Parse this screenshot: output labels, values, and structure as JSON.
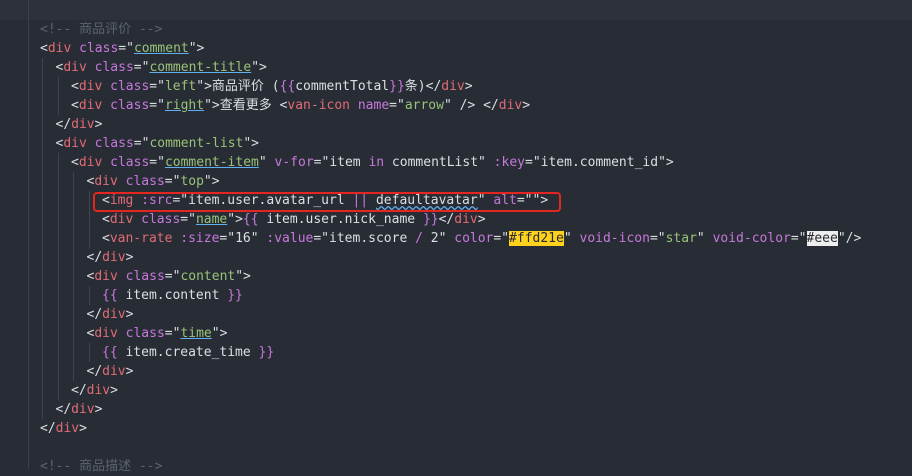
{
  "editor": {
    "highlight_color": "#e3261f",
    "swatch_colors": [
      "#ffd21e",
      "#eeeeee"
    ],
    "lines": [
      {
        "indent": 0,
        "tokens": [
          {
            "t": "<!-- 商品评价 -->",
            "c": "comment"
          }
        ]
      },
      {
        "indent": 0,
        "tokens": [
          {
            "t": "<",
            "c": "punc"
          },
          {
            "t": "div",
            "c": "tag"
          },
          {
            "t": " class",
            "c": "attr"
          },
          {
            "t": "=\"",
            "c": "punc"
          },
          {
            "t": "comment",
            "c": "str under"
          },
          {
            "t": "\">",
            "c": "punc"
          }
        ]
      },
      {
        "indent": 1,
        "tokens": [
          {
            "t": "<",
            "c": "punc"
          },
          {
            "t": "div",
            "c": "tag"
          },
          {
            "t": " class",
            "c": "attr"
          },
          {
            "t": "=\"",
            "c": "punc"
          },
          {
            "t": "comment-title",
            "c": "str under"
          },
          {
            "t": "\">",
            "c": "punc"
          }
        ]
      },
      {
        "indent": 2,
        "tokens": [
          {
            "t": "<",
            "c": "punc"
          },
          {
            "t": "div",
            "c": "tag"
          },
          {
            "t": " class",
            "c": "attr"
          },
          {
            "t": "=\"",
            "c": "punc"
          },
          {
            "t": "left",
            "c": "str"
          },
          {
            "t": "\">",
            "c": "punc"
          },
          {
            "t": "商品评价 (",
            "c": "plain"
          },
          {
            "t": "{{",
            "c": "attr"
          },
          {
            "t": "commentTotal",
            "c": "plain"
          },
          {
            "t": "}}",
            "c": "attr"
          },
          {
            "t": "条)",
            "c": "plain"
          },
          {
            "t": "</",
            "c": "punc"
          },
          {
            "t": "div",
            "c": "tag"
          },
          {
            "t": ">",
            "c": "punc"
          }
        ]
      },
      {
        "indent": 2,
        "tokens": [
          {
            "t": "<",
            "c": "punc"
          },
          {
            "t": "div",
            "c": "tag"
          },
          {
            "t": " class",
            "c": "attr"
          },
          {
            "t": "=\"",
            "c": "punc"
          },
          {
            "t": "right",
            "c": "str under"
          },
          {
            "t": "\">",
            "c": "punc"
          },
          {
            "t": "查看更多 ",
            "c": "plain"
          },
          {
            "t": "<",
            "c": "punc"
          },
          {
            "t": "van-icon",
            "c": "tag"
          },
          {
            "t": " name",
            "c": "attr"
          },
          {
            "t": "=\"",
            "c": "punc"
          },
          {
            "t": "arrow",
            "c": "str"
          },
          {
            "t": "\" /> ",
            "c": "punc"
          },
          {
            "t": "</",
            "c": "punc"
          },
          {
            "t": "div",
            "c": "tag"
          },
          {
            "t": ">",
            "c": "punc"
          }
        ]
      },
      {
        "indent": 1,
        "tokens": [
          {
            "t": "</",
            "c": "punc"
          },
          {
            "t": "div",
            "c": "tag"
          },
          {
            "t": ">",
            "c": "punc"
          }
        ]
      },
      {
        "indent": 1,
        "tokens": [
          {
            "t": "<",
            "c": "punc"
          },
          {
            "t": "div",
            "c": "tag"
          },
          {
            "t": " class",
            "c": "attr"
          },
          {
            "t": "=\"",
            "c": "punc"
          },
          {
            "t": "comment-list",
            "c": "str"
          },
          {
            "t": "\">",
            "c": "punc"
          }
        ]
      },
      {
        "indent": 2,
        "tokens": [
          {
            "t": "<",
            "c": "punc"
          },
          {
            "t": "div",
            "c": "tag"
          },
          {
            "t": " class",
            "c": "attr"
          },
          {
            "t": "=\"",
            "c": "punc"
          },
          {
            "t": "comment-item",
            "c": "str under"
          },
          {
            "t": "\"",
            "c": "punc"
          },
          {
            "t": " v-for",
            "c": "attr"
          },
          {
            "t": "=\"",
            "c": "punc"
          },
          {
            "t": "item ",
            "c": "plain"
          },
          {
            "t": "in",
            "c": "kw"
          },
          {
            "t": " commentList",
            "c": "plain"
          },
          {
            "t": "\"",
            "c": "punc"
          },
          {
            "t": " :key",
            "c": "attr"
          },
          {
            "t": "=\"",
            "c": "punc"
          },
          {
            "t": "item.comment_id",
            "c": "plain"
          },
          {
            "t": "\">",
            "c": "punc"
          }
        ]
      },
      {
        "indent": 3,
        "tokens": [
          {
            "t": "<",
            "c": "punc"
          },
          {
            "t": "div",
            "c": "tag"
          },
          {
            "t": " class",
            "c": "attr"
          },
          {
            "t": "=\"",
            "c": "punc"
          },
          {
            "t": "top",
            "c": "str"
          },
          {
            "t": "\">",
            "c": "punc"
          }
        ]
      },
      {
        "indent": 4,
        "tokens": [
          {
            "t": "<",
            "c": "punc"
          },
          {
            "t": "img",
            "c": "tag"
          },
          {
            "t": " :src",
            "c": "attr"
          },
          {
            "t": "=\"",
            "c": "punc"
          },
          {
            "t": "item.user.avatar_url ",
            "c": "plain"
          },
          {
            "t": "||",
            "c": "kw"
          },
          {
            "t": " ",
            "c": "plain"
          },
          {
            "t": "defaultavatar",
            "c": "plain wavy"
          },
          {
            "t": "\"",
            "c": "punc"
          },
          {
            "t": " alt",
            "c": "attr"
          },
          {
            "t": "=\"\">",
            "c": "punc"
          }
        ]
      },
      {
        "indent": 4,
        "tokens": [
          {
            "t": "<",
            "c": "punc"
          },
          {
            "t": "div",
            "c": "tag"
          },
          {
            "t": " class",
            "c": "attr"
          },
          {
            "t": "=\"",
            "c": "punc"
          },
          {
            "t": "name",
            "c": "str under"
          },
          {
            "t": "\">",
            "c": "punc"
          },
          {
            "t": "{{",
            "c": "attr"
          },
          {
            "t": " item.user.nick_name ",
            "c": "plain"
          },
          {
            "t": "}}",
            "c": "attr"
          },
          {
            "t": "</",
            "c": "punc"
          },
          {
            "t": "div",
            "c": "tag"
          },
          {
            "t": ">",
            "c": "punc"
          }
        ]
      },
      {
        "indent": 4,
        "tokens": [
          {
            "t": "<",
            "c": "punc"
          },
          {
            "t": "van-rate",
            "c": "tag"
          },
          {
            "t": " :size",
            "c": "attr"
          },
          {
            "t": "=\"",
            "c": "punc"
          },
          {
            "t": "16",
            "c": "plain"
          },
          {
            "t": "\"",
            "c": "punc"
          },
          {
            "t": " :value",
            "c": "attr"
          },
          {
            "t": "=\"",
            "c": "punc"
          },
          {
            "t": "item.score ",
            "c": "plain"
          },
          {
            "t": "/",
            "c": "kw"
          },
          {
            "t": " 2",
            "c": "plain"
          },
          {
            "t": "\"",
            "c": "punc"
          },
          {
            "t": " color",
            "c": "attr"
          },
          {
            "t": "=\"",
            "c": "punc"
          },
          {
            "t": "#ffd21e",
            "c": "swatch-yellow"
          },
          {
            "t": "\"",
            "c": "punc"
          },
          {
            "t": " void-icon",
            "c": "attr"
          },
          {
            "t": "=\"",
            "c": "punc"
          },
          {
            "t": "star",
            "c": "str"
          },
          {
            "t": "\"",
            "c": "punc"
          },
          {
            "t": " void-color",
            "c": "attr"
          },
          {
            "t": "=\"",
            "c": "punc"
          },
          {
            "t": "#eee",
            "c": "swatch-gray"
          },
          {
            "t": "\"/>",
            "c": "punc"
          }
        ]
      },
      {
        "indent": 3,
        "tokens": [
          {
            "t": "</",
            "c": "punc"
          },
          {
            "t": "div",
            "c": "tag"
          },
          {
            "t": ">",
            "c": "punc"
          }
        ]
      },
      {
        "indent": 3,
        "tokens": [
          {
            "t": "<",
            "c": "punc"
          },
          {
            "t": "div",
            "c": "tag"
          },
          {
            "t": " class",
            "c": "attr"
          },
          {
            "t": "=\"",
            "c": "punc"
          },
          {
            "t": "content",
            "c": "str"
          },
          {
            "t": "\">",
            "c": "punc"
          }
        ]
      },
      {
        "indent": 4,
        "tokens": [
          {
            "t": "{{",
            "c": "attr"
          },
          {
            "t": " item.content ",
            "c": "plain"
          },
          {
            "t": "}}",
            "c": "attr"
          }
        ]
      },
      {
        "indent": 3,
        "tokens": [
          {
            "t": "</",
            "c": "punc"
          },
          {
            "t": "div",
            "c": "tag"
          },
          {
            "t": ">",
            "c": "punc"
          }
        ]
      },
      {
        "indent": 3,
        "tokens": [
          {
            "t": "<",
            "c": "punc"
          },
          {
            "t": "div",
            "c": "tag"
          },
          {
            "t": " class",
            "c": "attr"
          },
          {
            "t": "=\"",
            "c": "punc"
          },
          {
            "t": "time",
            "c": "str under"
          },
          {
            "t": "\">",
            "c": "punc"
          }
        ]
      },
      {
        "indent": 4,
        "tokens": [
          {
            "t": "{{",
            "c": "attr"
          },
          {
            "t": " item.create_time ",
            "c": "plain"
          },
          {
            "t": "}}",
            "c": "attr"
          }
        ]
      },
      {
        "indent": 3,
        "tokens": [
          {
            "t": "</",
            "c": "punc"
          },
          {
            "t": "div",
            "c": "tag"
          },
          {
            "t": ">",
            "c": "punc"
          }
        ]
      },
      {
        "indent": 2,
        "tokens": [
          {
            "t": "</",
            "c": "punc"
          },
          {
            "t": "div",
            "c": "tag"
          },
          {
            "t": ">",
            "c": "punc"
          }
        ]
      },
      {
        "indent": 1,
        "tokens": [
          {
            "t": "</",
            "c": "punc"
          },
          {
            "t": "div",
            "c": "tag"
          },
          {
            "t": ">",
            "c": "punc"
          }
        ]
      },
      {
        "indent": 0,
        "tokens": [
          {
            "t": "</",
            "c": "punc"
          },
          {
            "t": "div",
            "c": "tag"
          },
          {
            "t": ">",
            "c": "punc"
          }
        ]
      },
      {
        "indent": 0,
        "tokens": []
      },
      {
        "indent": 0,
        "tokens": [
          {
            "t": "<!-- 商品描述 -->",
            "c": "comment"
          }
        ]
      }
    ]
  }
}
